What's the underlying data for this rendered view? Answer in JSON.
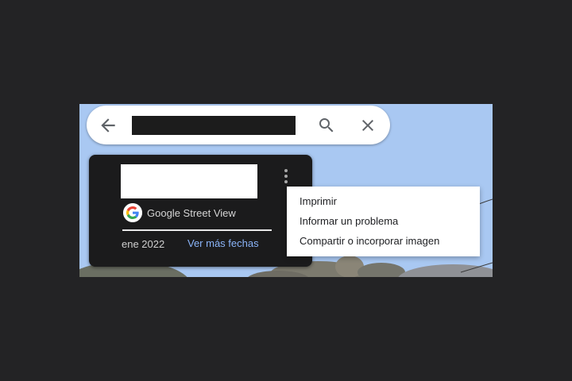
{
  "search": {
    "query": "",
    "back_icon": "arrow-back-icon",
    "search_icon": "search-icon",
    "close_icon": "close-icon"
  },
  "info_card": {
    "title": "",
    "source": "Google Street View",
    "source_icon": "google-g-logo",
    "capture_date": "ene 2022",
    "more_dates": "Ver más fechas",
    "more_icon": "more-vert-icon"
  },
  "menu": {
    "items": [
      {
        "label": "Imprimir"
      },
      {
        "label": "Informar un problema"
      },
      {
        "label": "Compartir o incorporar imagen"
      }
    ]
  },
  "colors": {
    "page_background": "#232325",
    "card_background": "#1b1b1c",
    "link": "#8ab4f8",
    "sky": "#a9c8f2"
  }
}
